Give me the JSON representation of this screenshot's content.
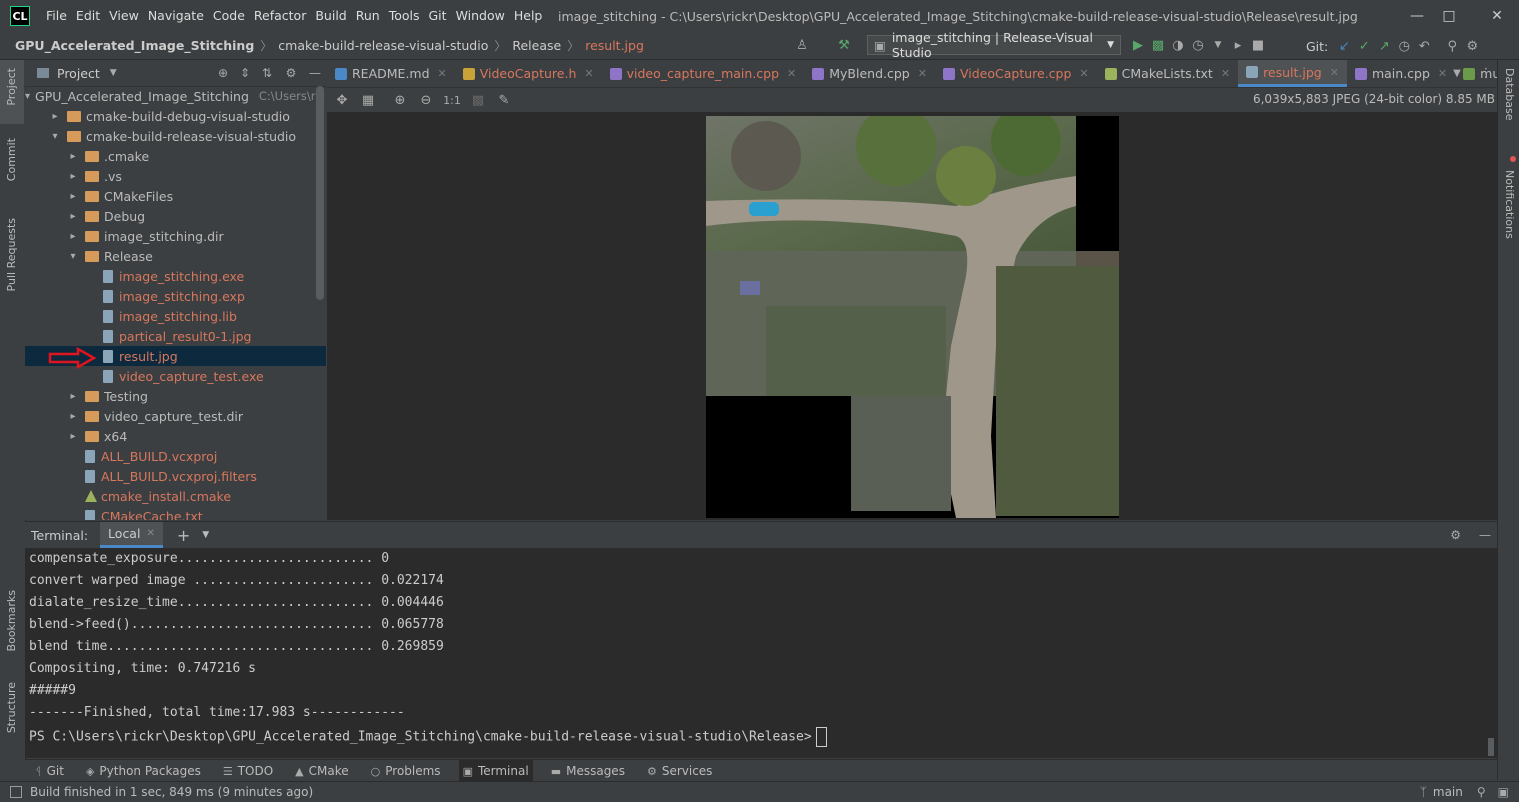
{
  "app": {
    "logo": "CL",
    "menu": [
      "File",
      "Edit",
      "View",
      "Navigate",
      "Code",
      "Refactor",
      "Build",
      "Run",
      "Tools",
      "Git",
      "Window",
      "Help"
    ],
    "window_title": "image_stitching - C:\\Users\\rickr\\Desktop\\GPU_Accelerated_Image_Stitching\\cmake-build-release-visual-studio\\Release\\result.jpg"
  },
  "navbar": {
    "breadcrumbs": [
      "GPU_Accelerated_Image_Stitching",
      "cmake-build-release-visual-studio",
      "Release",
      "result.jpg"
    ],
    "run_config": "image_stitching | Release-Visual Studio",
    "git_label": "Git:"
  },
  "left_strip": {
    "tabs": [
      "Project",
      "Commit",
      "Pull Requests",
      "Bookmarks",
      "Structure"
    ]
  },
  "project": {
    "title": "Project",
    "tree": [
      {
        "label": "GPU_Accelerated_Image_Stitching",
        "hint": "C:\\Users\\rickr",
        "type": "folder",
        "state": "open",
        "level": 0
      },
      {
        "label": "cmake-build-debug-visual-studio",
        "type": "folder",
        "state": "closed",
        "level": 1
      },
      {
        "label": "cmake-build-release-visual-studio",
        "type": "folder",
        "state": "open",
        "level": 1
      },
      {
        "label": ".cmake",
        "type": "folder",
        "state": "closed",
        "level": 2
      },
      {
        "label": ".vs",
        "type": "folder",
        "state": "closed",
        "level": 2
      },
      {
        "label": "CMakeFiles",
        "type": "folder",
        "state": "closed",
        "level": 2
      },
      {
        "label": "Debug",
        "type": "folder",
        "state": "closed",
        "level": 2
      },
      {
        "label": "image_stitching.dir",
        "type": "folder",
        "state": "closed",
        "level": 2
      },
      {
        "label": "Release",
        "type": "folder",
        "state": "open",
        "level": 2
      },
      {
        "label": "image_stitching.exe",
        "type": "file",
        "level": 3,
        "red": true
      },
      {
        "label": "image_stitching.exp",
        "type": "file",
        "level": 3,
        "red": true
      },
      {
        "label": "image_stitching.lib",
        "type": "file",
        "level": 3,
        "red": true
      },
      {
        "label": "partical_result0-1.jpg",
        "type": "file",
        "level": 3,
        "red": true
      },
      {
        "label": "result.jpg",
        "type": "file",
        "level": 3,
        "red": true,
        "selected": true
      },
      {
        "label": "video_capture_test.exe",
        "type": "file",
        "level": 3,
        "red": true
      },
      {
        "label": "Testing",
        "type": "folder",
        "state": "closed",
        "level": 2
      },
      {
        "label": "video_capture_test.dir",
        "type": "folder",
        "state": "closed",
        "level": 2
      },
      {
        "label": "x64",
        "type": "folder",
        "state": "closed",
        "level": 2
      },
      {
        "label": "ALL_BUILD.vcxproj",
        "type": "file",
        "level": 2,
        "red": true
      },
      {
        "label": "ALL_BUILD.vcxproj.filters",
        "type": "file",
        "level": 2,
        "red": true
      },
      {
        "label": "cmake_install.cmake",
        "type": "cmake",
        "level": 2,
        "red": true
      },
      {
        "label": "CMakeCache.txt",
        "type": "file",
        "level": 2,
        "red": true
      }
    ]
  },
  "editor": {
    "tabs": [
      {
        "label": "README.md",
        "color": "#4a88c7",
        "red": false
      },
      {
        "label": "VideoCapture.h",
        "color": "#c9a23a",
        "red": true
      },
      {
        "label": "video_capture_main.cpp",
        "color": "#8f75c7",
        "red": true
      },
      {
        "label": "MyBlend.cpp",
        "color": "#8f75c7",
        "red": false
      },
      {
        "label": "VideoCapture.cpp",
        "color": "#8f75c7",
        "red": true
      },
      {
        "label": "CMakeLists.txt",
        "color": "#9ab35c",
        "red": false
      },
      {
        "label": "result.jpg",
        "color": "#8aa4b8",
        "red": true,
        "active": true
      },
      {
        "label": "main.cpp",
        "color": "#8f75c7",
        "red": false
      },
      {
        "label": "multiband_b",
        "color": "#6a9a4a",
        "red": false
      }
    ],
    "zoom_label": "1:1",
    "image_info": "6,039x5,883 JPEG (24-bit color) 8.85 MB"
  },
  "right_strip": {
    "tabs": [
      "Database",
      "Notifications"
    ]
  },
  "terminal": {
    "label": "Terminal:",
    "tab": "Local",
    "lines": [
      "compensate_exposure......................... 0",
      "convert warped image ....................... 0.022174",
      "dialate_resize_time......................... 0.004446",
      "blend->feed()............................... 0.065778",
      "blend time.................................. 0.269859",
      "Compositing, time: 0.747216 s",
      "#####9",
      "-------Finished, total time:17.983 s------------"
    ],
    "prompt": "PS C:\\Users\\rickr\\Desktop\\GPU_Accelerated_Image_Stitching\\cmake-build-release-visual-studio\\Release>"
  },
  "bottom_tabs": [
    {
      "label": "Git",
      "icon": "branch-icon"
    },
    {
      "label": "Python Packages",
      "icon": "layers-icon"
    },
    {
      "label": "TODO",
      "icon": "list-icon"
    },
    {
      "label": "CMake",
      "icon": "triangle-icon"
    },
    {
      "label": "Problems",
      "icon": "warning-icon"
    },
    {
      "label": "Terminal",
      "icon": "terminal-icon",
      "active": true
    },
    {
      "label": "Messages",
      "icon": "messages-icon"
    },
    {
      "label": "Services",
      "icon": "services-icon"
    }
  ],
  "status": {
    "message": "Build finished in 1 sec, 849 ms (9 minutes ago)",
    "branch": "main"
  },
  "colors": {
    "accent": "#4a88c7",
    "selection": "#0d293e",
    "unversioned_file": "#d7775d",
    "annotation_arrow": "#e0141e"
  }
}
